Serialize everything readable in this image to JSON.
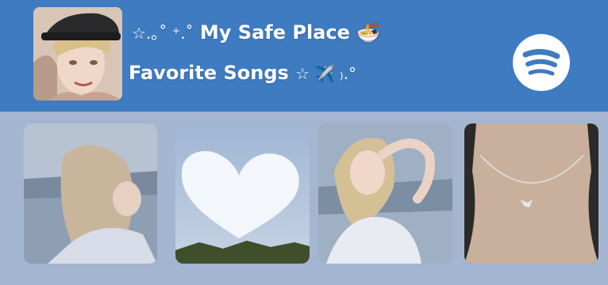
{
  "header": {
    "line1": {
      "deco": "☆.｡˚ ⁺.˚",
      "title": "My Safe Place",
      "emoji": "🍜"
    },
    "line2": {
      "subtitle": "Favorite Songs",
      "deco": "☆ ✈️ ₎.°"
    },
    "cover_image": "profile-portrait-photo",
    "spotify_icon": "spotify-icon"
  },
  "gallery": [
    {
      "name": "photo-woman-looking-down",
      "kind": "photo"
    },
    {
      "name": "photo-heart-cloud-sky",
      "kind": "photo"
    },
    {
      "name": "photo-woman-hand-on-head",
      "kind": "photo"
    },
    {
      "name": "photo-butterfly-necklace",
      "kind": "photo"
    }
  ],
  "colors": {
    "header_bg": "#3e7bc0",
    "page_bg": "#a3b5d0",
    "text": "#ffffff"
  }
}
